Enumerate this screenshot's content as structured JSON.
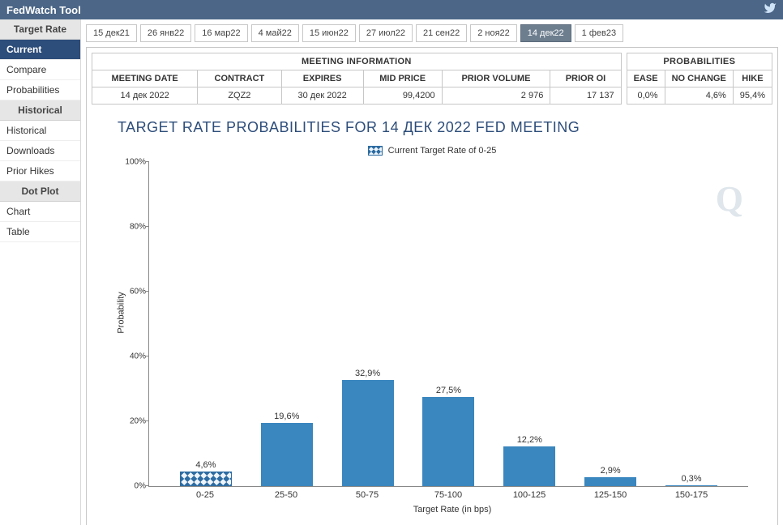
{
  "header": {
    "title": "FedWatch Tool"
  },
  "sidebar": {
    "groups": [
      {
        "title": "Target Rate",
        "items": [
          "Current",
          "Compare",
          "Probabilities"
        ],
        "active": 0
      },
      {
        "title": "Historical",
        "items": [
          "Historical",
          "Downloads",
          "Prior Hikes"
        ]
      },
      {
        "title": "Dot Plot",
        "items": [
          "Chart",
          "Table"
        ]
      }
    ]
  },
  "tabs": {
    "items": [
      "15 дек21",
      "26 янв22",
      "16 мар22",
      "4 май22",
      "15 июн22",
      "27 июл22",
      "21 сен22",
      "2 ноя22",
      "14 дек22",
      "1 фев23"
    ],
    "active": 8
  },
  "meeting_info": {
    "section_title": "MEETING INFORMATION",
    "headers": [
      "MEETING DATE",
      "CONTRACT",
      "EXPIRES",
      "MID PRICE",
      "PRIOR VOLUME",
      "PRIOR OI"
    ],
    "row": [
      "14 дек 2022",
      "ZQZ2",
      "30 дек 2022",
      "99,4200",
      "2 976",
      "17 137"
    ]
  },
  "probabilities": {
    "section_title": "PROBABILITIES",
    "headers": [
      "EASE",
      "NO CHANGE",
      "HIKE"
    ],
    "row": [
      "0,0%",
      "4,6%",
      "95,4%"
    ]
  },
  "chart": {
    "title": "TARGET RATE PROBABILITIES FOR 14 ДЕК 2022 FED MEETING",
    "legend": "Current Target Rate of 0-25",
    "ylabel": "Probability",
    "xlabel": "Target Rate (in bps)"
  },
  "chart_data": {
    "type": "bar",
    "title": "TARGET RATE PROBABILITIES FOR 14 ДЕК 2022 FED MEETING",
    "xlabel": "Target Rate (in bps)",
    "ylabel": "Probability",
    "ylim": [
      0,
      100
    ],
    "yticks": [
      0,
      20,
      40,
      60,
      80,
      100
    ],
    "categories": [
      "0-25",
      "25-50",
      "50-75",
      "75-100",
      "100-125",
      "125-150",
      "150-175"
    ],
    "values": [
      4.6,
      19.6,
      32.9,
      27.5,
      12.2,
      2.9,
      0.3
    ],
    "value_labels": [
      "4,6%",
      "19,6%",
      "32,9%",
      "27,5%",
      "12,2%",
      "2,9%",
      "0,3%"
    ],
    "current_index": 0,
    "legend": "Current Target Rate of 0-25"
  }
}
